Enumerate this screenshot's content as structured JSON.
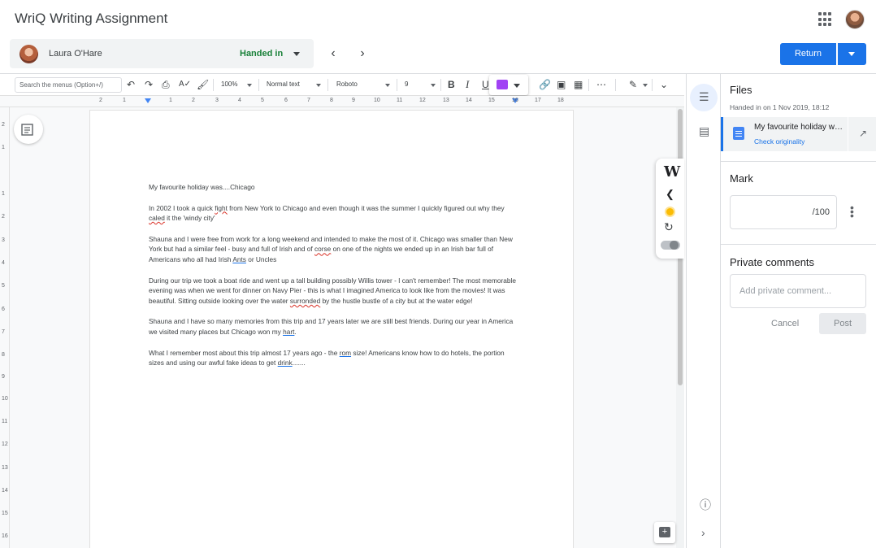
{
  "app": {
    "title": "WriQ Writing Assignment"
  },
  "student": {
    "name": "Laura O'Hare",
    "status": "Handed in"
  },
  "actions": {
    "return_label": "Return"
  },
  "toolbar": {
    "search_placeholder": "Search the menus (Option+/)",
    "zoom": "100%",
    "style": "Normal text",
    "font": "Roboto",
    "size": "9"
  },
  "ruler": {
    "numbers": [
      "2",
      "1",
      "1",
      "2",
      "3",
      "4",
      "5",
      "6",
      "7",
      "8",
      "9",
      "10",
      "11",
      "12",
      "13",
      "14",
      "15",
      "16",
      "17",
      "18"
    ]
  },
  "vruler": {
    "numbers": [
      "2",
      "1",
      "1",
      "2",
      "3",
      "4",
      "5",
      "6",
      "7",
      "8",
      "9",
      "10",
      "11",
      "12",
      "13",
      "14",
      "15",
      "16"
    ]
  },
  "document": {
    "title_line": "My favourite holiday was....Chicago",
    "paragraphs": [
      [
        {
          "t": "In 2002 I took a quick "
        },
        {
          "t": "fight",
          "s": "sp"
        },
        {
          "t": " from New York to Chicago and even though it was the summer I quickly figured out why they "
        },
        {
          "t": "caled",
          "s": "sp"
        },
        {
          "t": " it the 'windy city'"
        }
      ],
      [
        {
          "t": "Shauna and I were free from work for a long weekend and intended to make the most of it. Chicago was smaller than New York but had a similar feel - busy and full of Irish and of "
        },
        {
          "t": "corse",
          "s": "sp"
        },
        {
          "t": " on one of the nights we ended up in an Irish bar full of Americans who all had Irish "
        },
        {
          "t": "Ants",
          "s": "gr"
        },
        {
          "t": " or Uncles"
        }
      ],
      [
        {
          "t": "During our trip we took a boat ride and went up a tall building possibly Willis tower - I can't remember! The most memorable evening was when we went for dinner on Navy Pier - this is what I imagined America to look like from the movies! It was beautiful. Sitting outside looking over the water "
        },
        {
          "t": "surronded",
          "s": "sp"
        },
        {
          "t": " by the hustle bustle of a city but at the water edge!"
        }
      ],
      [
        {
          "t": "Shauna and I have so many memories from this trip and 17 years later we are still best friends. During our year in America we visited many places but Chicago won my "
        },
        {
          "t": "hart",
          "s": "gr"
        },
        {
          "t": "."
        }
      ],
      [
        {
          "t": "What I remember most about this trip almost 17 years ago - the "
        },
        {
          "t": "rom",
          "s": "gr"
        },
        {
          "t": " size! Americans know how to do hotels, the portion sizes and using our awful fake ideas to get "
        },
        {
          "t": "drink",
          "s": "gr"
        },
        {
          "t": "......."
        }
      ]
    ]
  },
  "files": {
    "heading": "Files",
    "handed_in": "Handed in on 1 Nov 2019, 18:12",
    "file_name": "My favourite holiday was....",
    "check_link": "Check originality"
  },
  "mark": {
    "heading": "Mark",
    "out_of": "/100"
  },
  "comments": {
    "heading": "Private comments",
    "placeholder": "Add private comment...",
    "cancel": "Cancel",
    "post": "Post"
  }
}
